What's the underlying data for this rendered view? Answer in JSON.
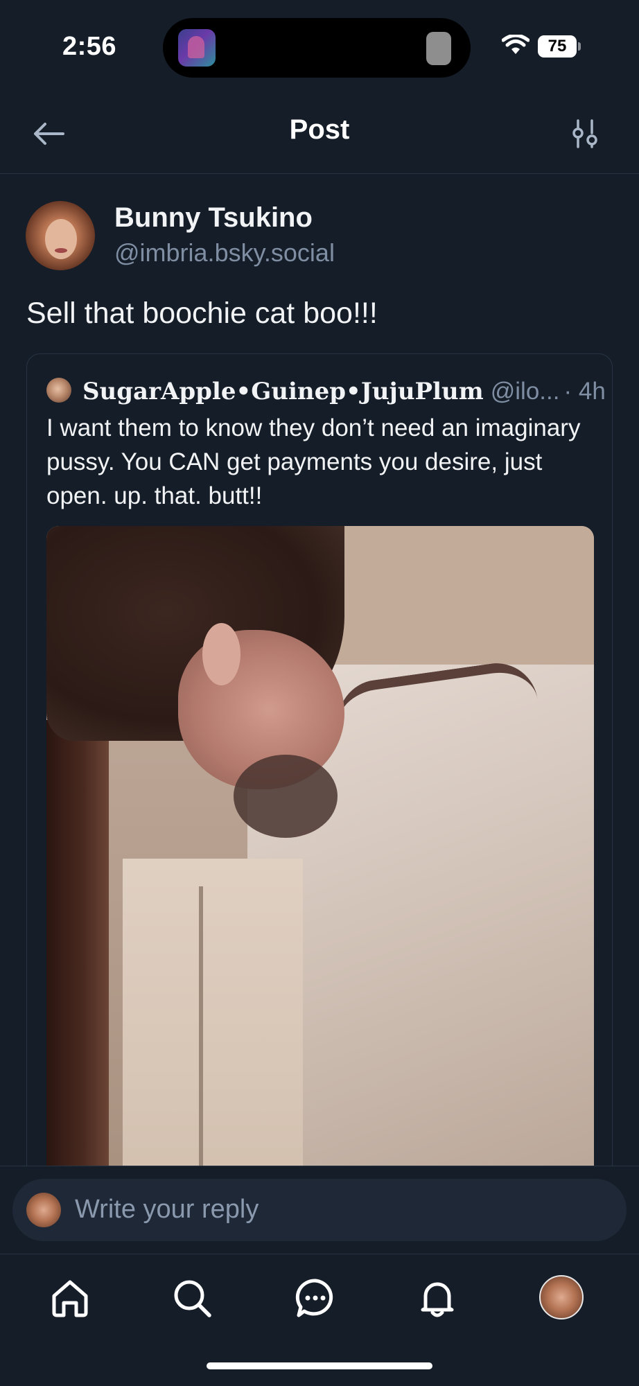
{
  "status_bar": {
    "time": "2:56",
    "battery": "75"
  },
  "header": {
    "title": "Post",
    "back_icon": "arrow-left-icon",
    "filter_icon": "sliders-icon"
  },
  "post": {
    "author_name": "Bunny Tsukino",
    "author_handle": "@imbria.bsky.social",
    "text": "Sell that boochie cat boo!!!",
    "quote": {
      "author_name": "SugarApple•Guinep•JujuPlum",
      "author_handle": "@ilo...",
      "time": "· 4h",
      "text": "I want them to know they don’t need an imaginary pussy. You CAN get payments you desire, just open. up. that. butt!!"
    }
  },
  "reply": {
    "placeholder": "Write your reply"
  },
  "tabs": [
    {
      "icon": "home-icon"
    },
    {
      "icon": "search-icon"
    },
    {
      "icon": "chat-icon"
    },
    {
      "icon": "bell-icon"
    },
    {
      "icon": "profile-avatar"
    }
  ],
  "colors": {
    "background": "#151d28",
    "text": "#f1f3f5",
    "muted": "#7f8ea3",
    "border": "#283444",
    "input_bg": "#1e2836"
  }
}
